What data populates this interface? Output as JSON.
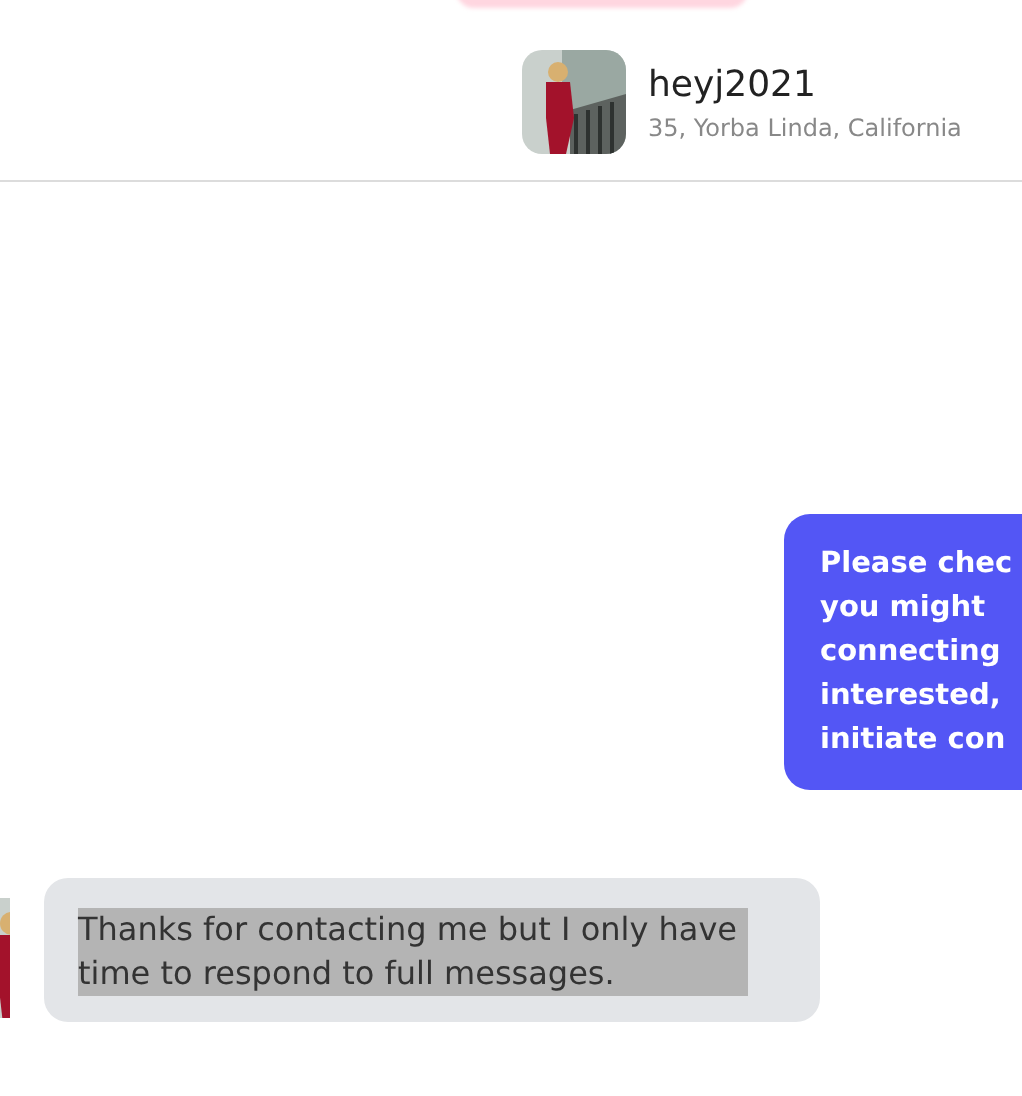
{
  "profile": {
    "username": "heyj2021",
    "details": "35, Yorba Linda, California"
  },
  "messages": [
    {
      "kind": "sent",
      "lines": [
        "Please chec",
        "you might",
        "connecting",
        "interested,",
        "initiate con"
      ]
    },
    {
      "kind": "received",
      "text": "Thanks for contacting me but I only have time to respond to full messages.",
      "selected": true
    }
  ]
}
